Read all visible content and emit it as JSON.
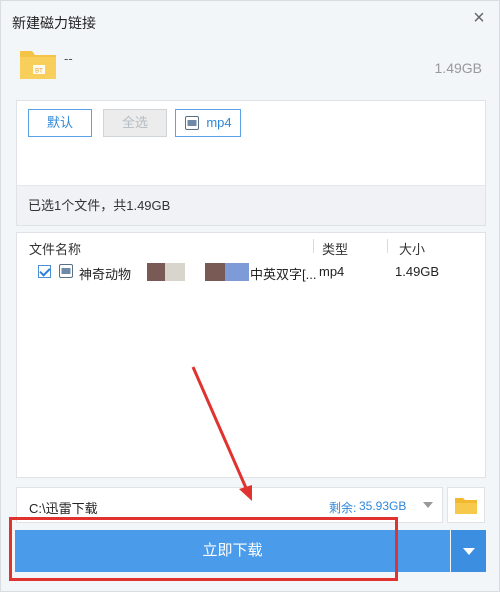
{
  "window": {
    "title": "新建磁力链接",
    "close_label": "×"
  },
  "torrent": {
    "name": "--",
    "size": "1.49GB",
    "icon": "folder-torrent-icon",
    "icon_text": "BT"
  },
  "filters": {
    "default_label": "默认",
    "all_label": "全选",
    "mp4_label": "mp4"
  },
  "summary": "已选1个文件，共1.49GB",
  "table": {
    "headers": {
      "name": "文件名称",
      "type": "类型",
      "size": "大小"
    },
    "rows": [
      {
        "checked": true,
        "name_start": "神奇动物",
        "name_end": "中英双字[...",
        "type": "mp4",
        "size": "1.49GB"
      }
    ]
  },
  "save": {
    "path": "C:\\迅雷下载",
    "free_label": "剩余:",
    "free_value": "35.93GB"
  },
  "actions": {
    "download_label": "立即下载"
  },
  "colors": {
    "accent": "#4a9bea",
    "annotation": "#e0332f"
  }
}
